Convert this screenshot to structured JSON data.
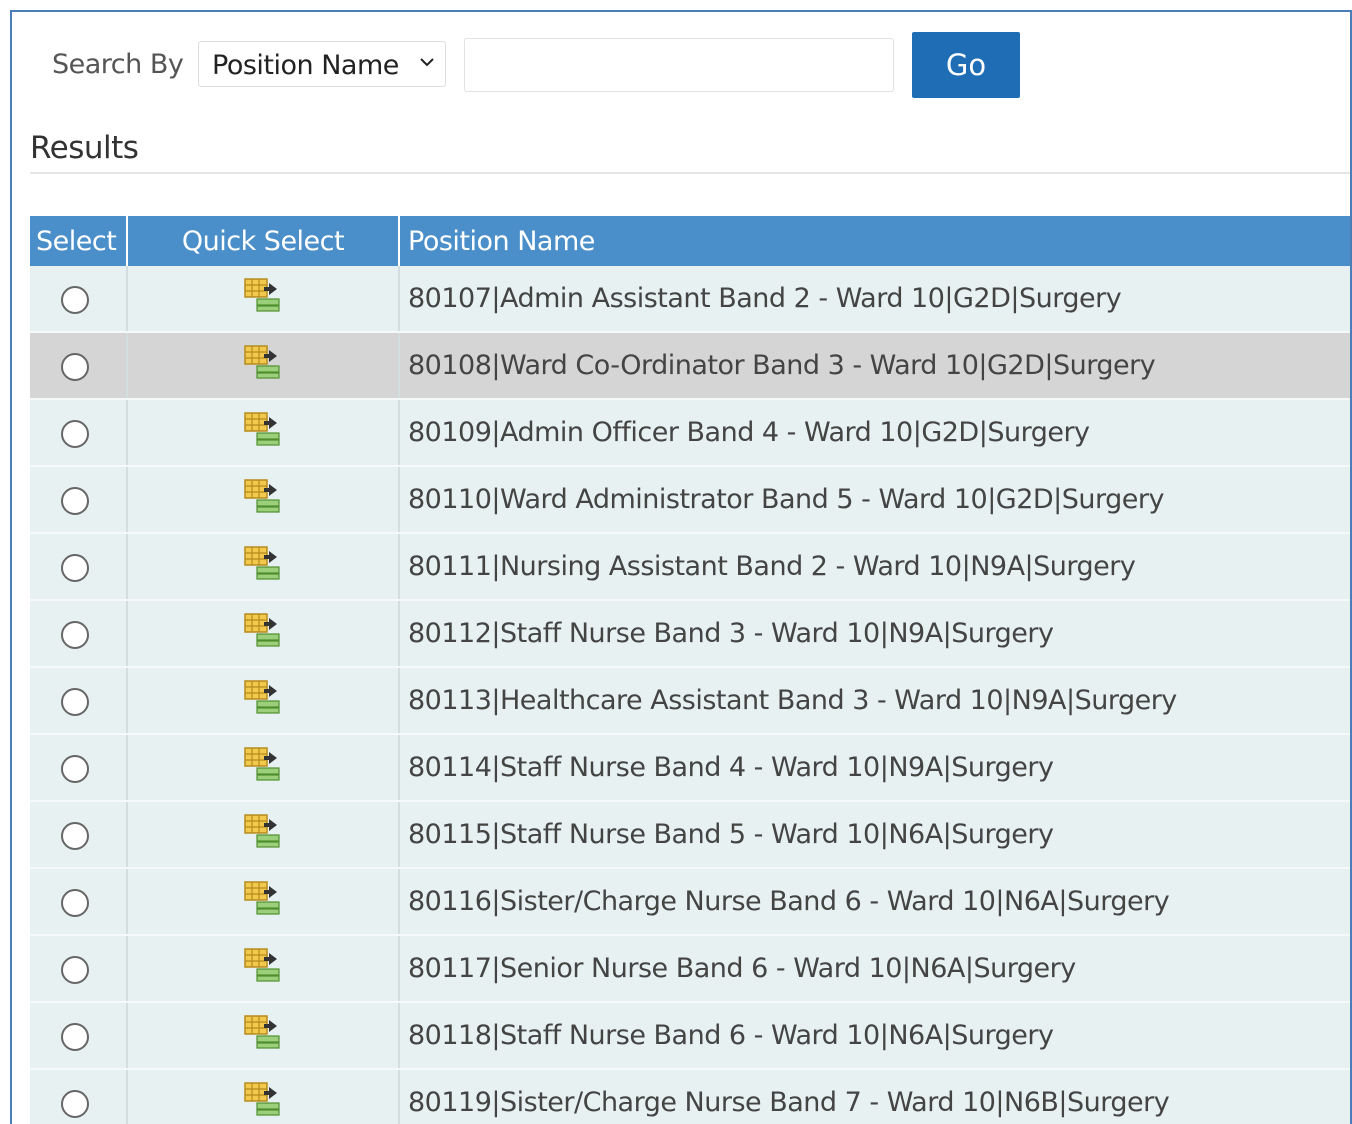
{
  "search": {
    "label": "Search By",
    "selected_option": "Position Name",
    "input_value": "",
    "input_placeholder": "",
    "go_label": "Go"
  },
  "results": {
    "title": "Results",
    "columns": {
      "select": "Select",
      "quick_select": "Quick Select",
      "position_name": "Position Name"
    },
    "quick_select_icon": "quick-select-icon",
    "highlighted_row_index": 1,
    "rows": [
      "80107|Admin Assistant Band 2 - Ward 10|G2D|Surgery",
      "80108|Ward Co-Ordinator Band 3 - Ward 10|G2D|Surgery",
      "80109|Admin Officer Band 4 - Ward 10|G2D|Surgery",
      "80110|Ward Administrator Band 5 - Ward 10|G2D|Surgery",
      "80111|Nursing Assistant Band 2 - Ward 10|N9A|Surgery",
      "80112|Staff Nurse Band 3 - Ward 10|N9A|Surgery",
      "80113|Healthcare Assistant Band 3 - Ward 10|N9A|Surgery",
      "80114|Staff Nurse Band 4 - Ward 10|N9A|Surgery",
      "80115|Staff Nurse Band 5 - Ward 10|N6A|Surgery",
      "80116|Sister/Charge Nurse Band 6 - Ward 10|N6A|Surgery",
      "80117|Senior Nurse Band 6 - Ward 10|N6A|Surgery",
      "80118|Staff Nurse Band 6 - Ward 10|N6A|Surgery",
      "80119|Sister/Charge Nurse Band 7 - Ward 10|N6B|Surgery"
    ]
  },
  "colors": {
    "header_bg": "#4a8fc9",
    "button_bg": "#1f6db5",
    "row_bg": "#e8f1f1",
    "selected_row_bg": "#d5d5d5"
  }
}
